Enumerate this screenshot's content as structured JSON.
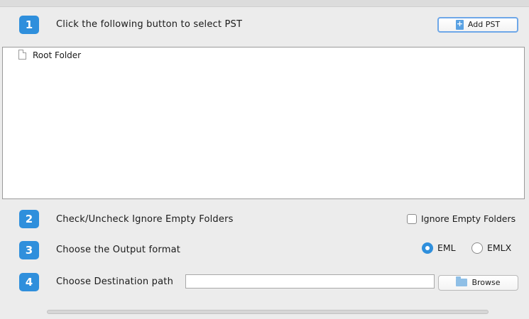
{
  "step1": {
    "number": "1",
    "label": "Click the following button to select PST",
    "button_label": "Add PST",
    "button_icon": "add-file-icon"
  },
  "tree": {
    "items": [
      {
        "label": "Root Folder",
        "icon": "document-icon"
      }
    ]
  },
  "step2": {
    "number": "2",
    "label": "Check/Uncheck Ignore Empty Folders",
    "checkbox_label": "Ignore Empty Folders",
    "checked": false
  },
  "step3": {
    "number": "3",
    "label": "Choose the Output format",
    "options": [
      {
        "label": "EML",
        "selected": true
      },
      {
        "label": "EMLX",
        "selected": false
      }
    ]
  },
  "step4": {
    "number": "4",
    "label": "Choose Destination path",
    "path_value": "",
    "button_label": "Browse",
    "button_icon": "folder-icon"
  },
  "colors": {
    "accent": "#2f8fdc",
    "background": "#ececec",
    "panel": "#ffffff"
  }
}
